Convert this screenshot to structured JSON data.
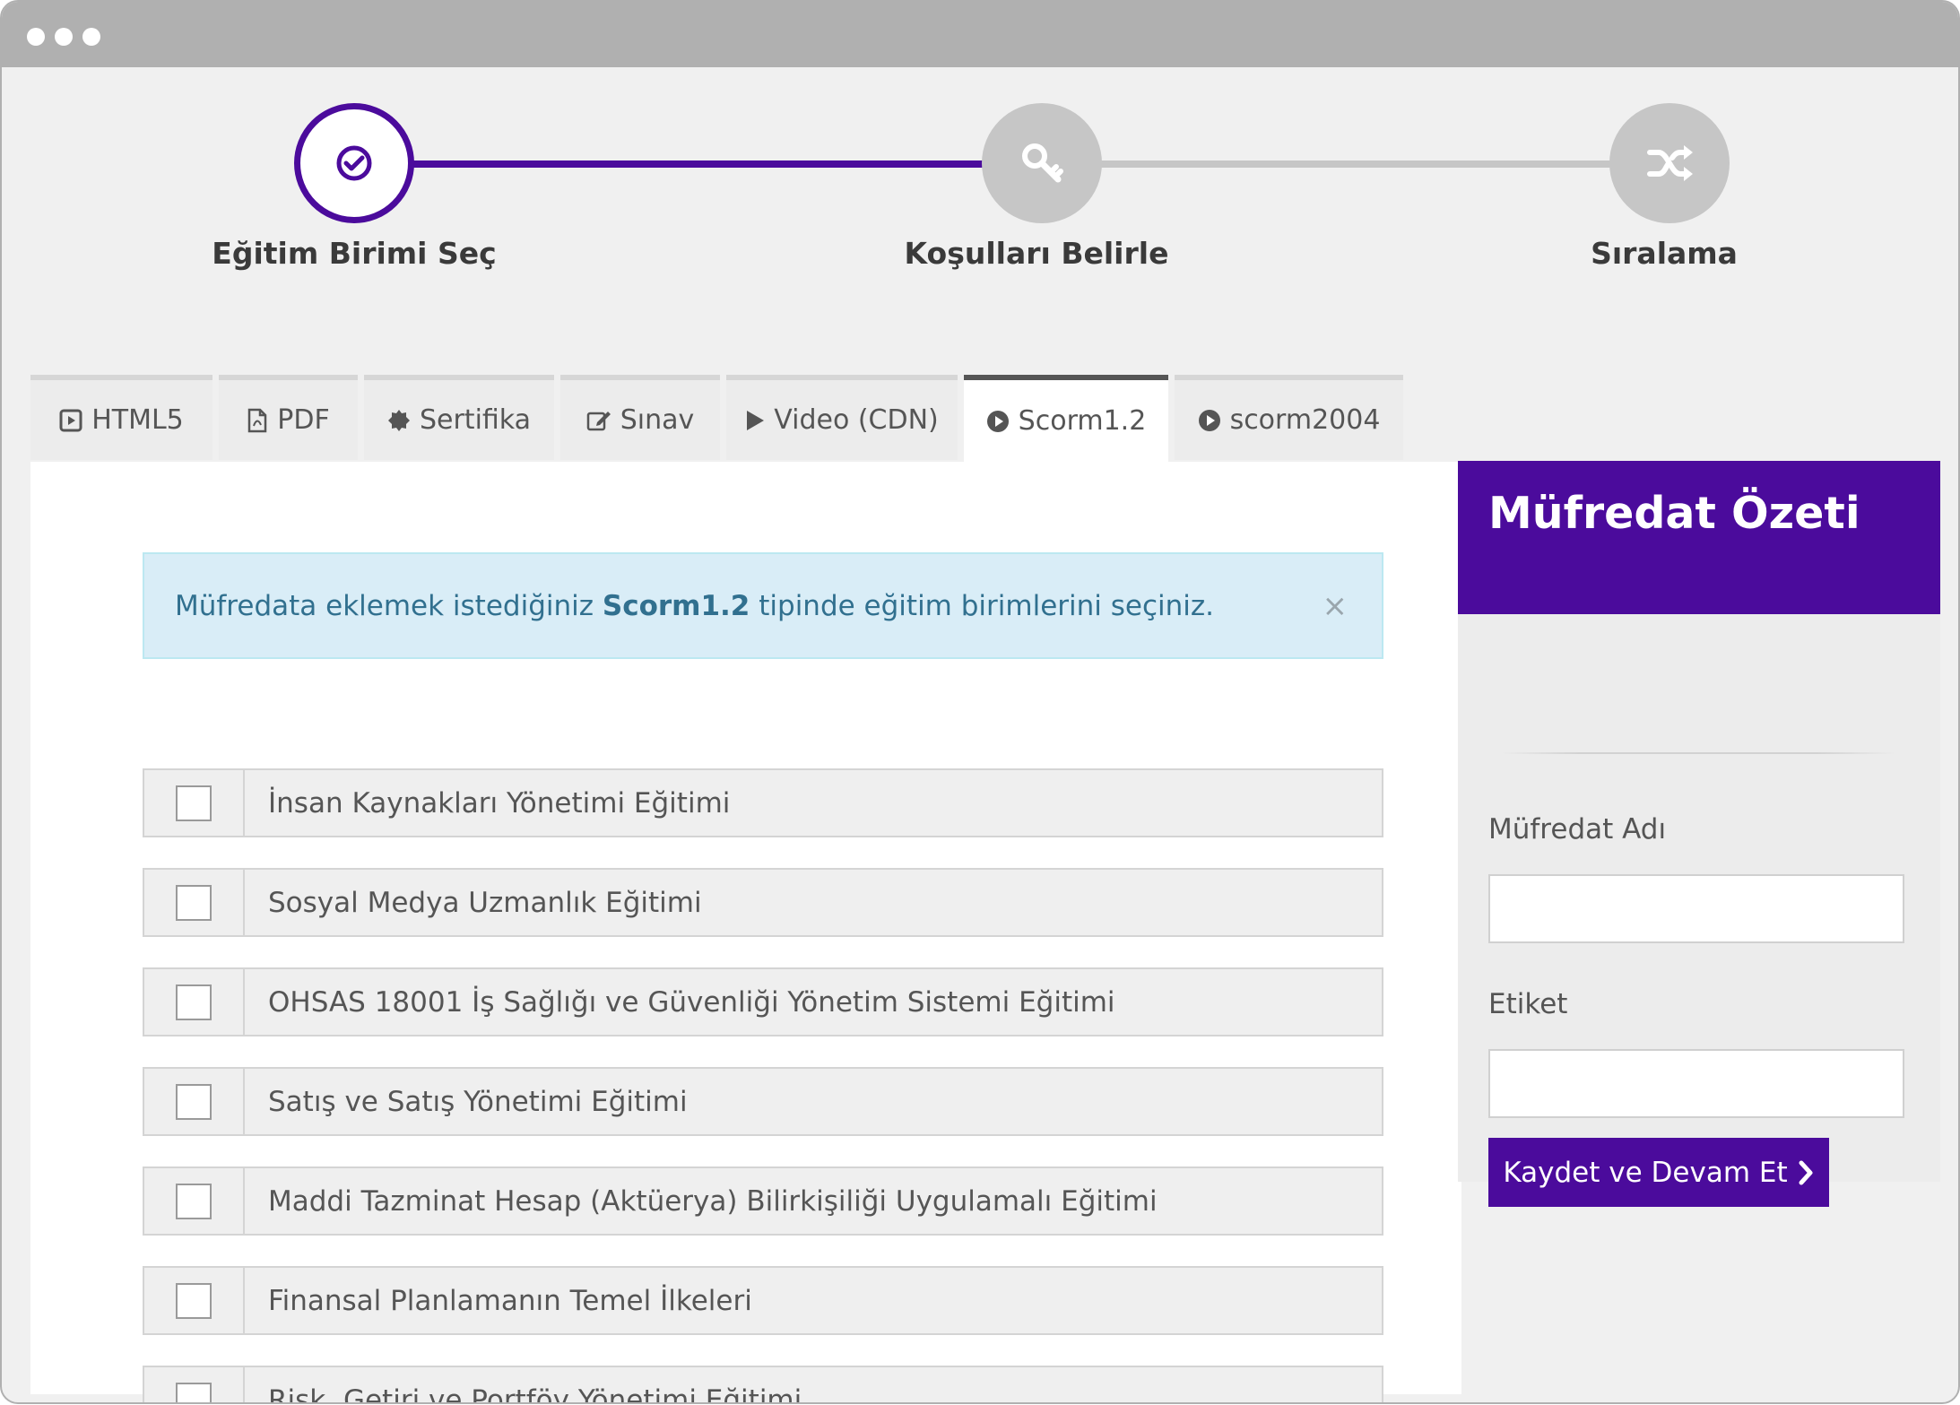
{
  "stepper": {
    "steps": [
      {
        "label": "Eğitim Birimi Seç",
        "icon": "check-circle-icon",
        "state": "active"
      },
      {
        "label": "Koşulları Belirle",
        "icon": "key-icon",
        "state": "pending"
      },
      {
        "label": "Sıralama",
        "icon": "shuffle-icon",
        "state": "pending"
      }
    ],
    "colors": {
      "active": "#4b0b9c",
      "pending": "#c6c6c6"
    }
  },
  "tabs": [
    {
      "label": "HTML5",
      "icon": "play-square-icon",
      "active": false
    },
    {
      "label": "PDF",
      "icon": "file-pdf-icon",
      "active": false
    },
    {
      "label": "Sertifika",
      "icon": "certificate-icon",
      "active": false
    },
    {
      "label": "Sınav",
      "icon": "edit-icon",
      "active": false
    },
    {
      "label": "Video (CDN)",
      "icon": "play-icon",
      "active": false
    },
    {
      "label": "Scorm1.2",
      "icon": "play-circle-icon",
      "active": true
    },
    {
      "label": "scorm2004",
      "icon": "play-circle-icon",
      "active": false
    }
  ],
  "alert": {
    "text_before": "Müfredata eklemek istediğiniz ",
    "highlight": "Scorm1.2",
    "text_after": " tipinde eğitim birimlerini seçiniz.",
    "close": "×"
  },
  "courses": [
    {
      "label": "İnsan Kaynakları Yönetimi Eğitimi",
      "checked": false
    },
    {
      "label": "Sosyal Medya Uzmanlık Eğitimi",
      "checked": false
    },
    {
      "label": "OHSAS 18001 İş Sağlığı ve Güvenliği Yönetim Sistemi Eğitimi",
      "checked": false
    },
    {
      "label": "Satış ve Satış Yönetimi Eğitimi",
      "checked": false
    },
    {
      "label": "Maddi Tazminat Hesap (Aktüerya) Bilirkişiliği Uygulamalı Eğitimi",
      "checked": false
    },
    {
      "label": "Finansal Planlamanın Temel İlkeleri",
      "checked": false
    },
    {
      "label": "Risk, Getiri ve Portföy Yönetimi Eğitimi",
      "checked": false
    }
  ],
  "sidebar": {
    "title": "Müfredat Özeti",
    "name_label": "Müfredat Adı",
    "name_value": "",
    "tag_label": "Etiket",
    "tag_value": "",
    "submit_label": "Kaydet ve Devam Et",
    "accent": "#4b0b9c"
  }
}
